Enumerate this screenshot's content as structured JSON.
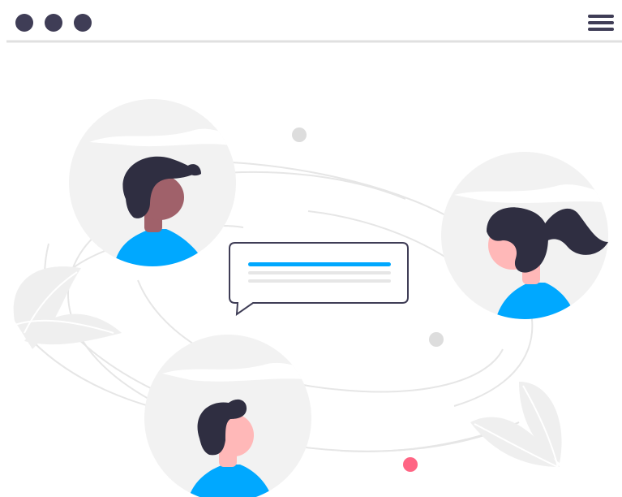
{
  "colors": {
    "dark": "#3f3d56",
    "hair": "#2f2e41",
    "accent": "#00a8ff",
    "skin_light": "#ffb8b8",
    "skin_dark": "#a0616a",
    "pink_dot": "#ff6584",
    "circle_bg": "#f2f2f2",
    "line_light": "#e6e6e6",
    "bar_grey": "#e6e6e6"
  },
  "icons": {
    "window_controls": [
      "window-dot-icon",
      "window-dot-icon",
      "window-dot-icon"
    ],
    "menu": "hamburger-menu-icon"
  }
}
